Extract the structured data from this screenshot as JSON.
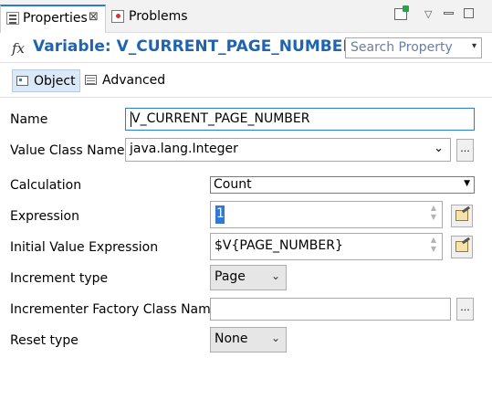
{
  "tabs": {
    "properties_label": "Properties",
    "properties_close": "⊠",
    "problems_label": "Problems"
  },
  "toolbar": {
    "icons": [
      "new-window-icon",
      "view-menu-icon",
      "minimize-icon",
      "maximize-icon"
    ]
  },
  "header": {
    "fx": "fx",
    "title": "Variable: V_CURRENT_PAGE_NUMBER",
    "search_placeholder": "Search Property",
    "search_arrow": "▾"
  },
  "subtabs": {
    "object_label": "Object",
    "advanced_label": "Advanced"
  },
  "form": {
    "name_label": "Name",
    "name_value": "V_CURRENT_PAGE_NUMBER",
    "value_class_label": "Value Class Name",
    "value_class_value": "java.lang.Integer",
    "calculation_label": "Calculation",
    "calculation_value": "Count",
    "expression_label": "Expression",
    "expression_value": "1",
    "initial_value_label": "Initial Value Expression",
    "initial_value_value": "$V{PAGE_NUMBER}",
    "increment_type_label": "Increment type",
    "increment_type_value": "Page",
    "incrementer_factory_label": "Incrementer Factory Class Name",
    "incrementer_factory_value": "",
    "reset_type_label": "Reset type",
    "reset_type_value": "None",
    "dots": "..."
  },
  "colors": {
    "title": "#1d64b1",
    "active_tab_border": "#2a7bd4",
    "selected_subtab": "#dbe8f7",
    "focus_border": "#2a7bd4",
    "selection": "#3478d6"
  }
}
